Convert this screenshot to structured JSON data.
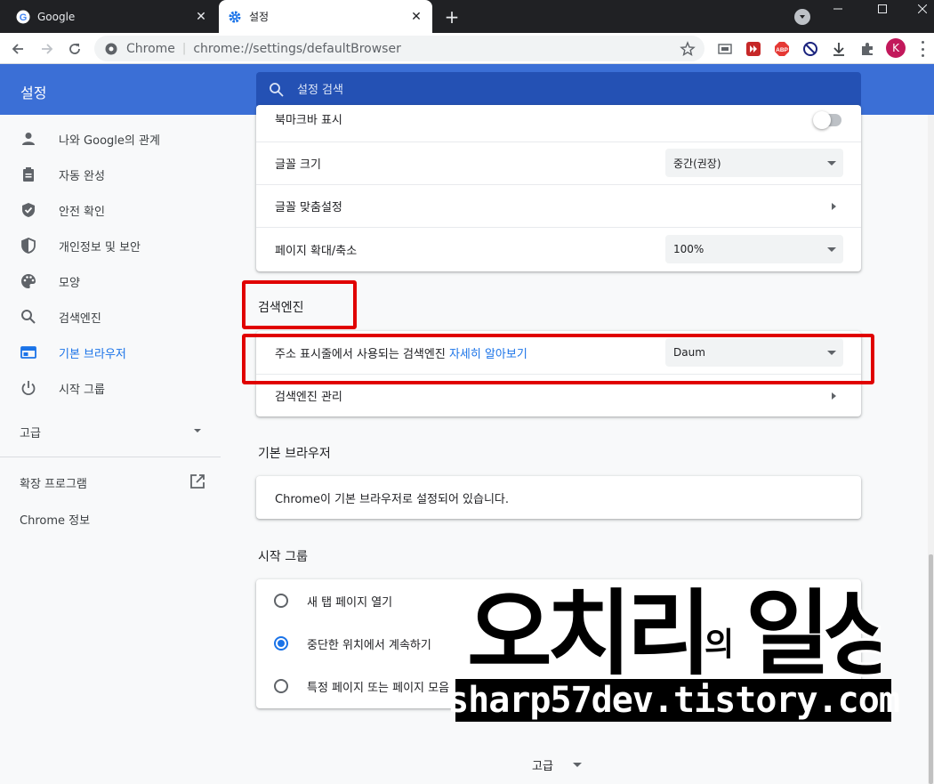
{
  "tabs": [
    {
      "title": "Google"
    },
    {
      "title": "설정"
    }
  ],
  "toolbar": {
    "chip_label": "Chrome",
    "url": "chrome://settings/defaultBrowser",
    "avatar_initial": "K"
  },
  "header": {
    "title": "설정",
    "search_placeholder": "설정 검색"
  },
  "sidebar": {
    "items": [
      {
        "label": "나와 Google의 관계",
        "icon": "person-icon"
      },
      {
        "label": "자동 완성",
        "icon": "clipboard-icon"
      },
      {
        "label": "안전 확인",
        "icon": "shield-check-icon"
      },
      {
        "label": "개인정보 및 보안",
        "icon": "shield-half-icon"
      },
      {
        "label": "모양",
        "icon": "palette-icon"
      },
      {
        "label": "검색엔진",
        "icon": "search-icon"
      },
      {
        "label": "기본 브라우저",
        "icon": "browser-icon",
        "selected": true
      },
      {
        "label": "시작 그룹",
        "icon": "power-icon"
      }
    ],
    "advanced": "고급",
    "extensions": "확장 프로그램",
    "about": "Chrome 정보"
  },
  "appearance": {
    "bookmark_bar_label": "북마크바 표시",
    "bookmark_bar_enabled": false,
    "font_size_label": "글꼴 크기",
    "font_size_value": "중간(권장)",
    "customize_fonts_label": "글꼴 맞춤설정",
    "page_zoom_label": "페이지 확대/축소",
    "page_zoom_value": "100%"
  },
  "search_engine": {
    "section_title": "검색엔진",
    "address_bar_label": "주소 표시줄에서 사용되는 검색엔진",
    "learn_more": "자세히 알아보기",
    "engine_value": "Daum",
    "manage_label": "검색엔진 관리"
  },
  "default_browser": {
    "section_title": "기본 브라우저",
    "status": "Chrome이 기본 브라우저로 설정되어 있습니다."
  },
  "startup": {
    "section_title": "시작 그룹",
    "options": [
      {
        "label": "새 탭 페이지 열기",
        "checked": false
      },
      {
        "label": "중단한 위치에서 계속하기",
        "checked": true
      },
      {
        "label": "특정 페이지 또는 페이지 모음",
        "checked": false
      }
    ]
  },
  "footer": {
    "advanced": "고급"
  },
  "watermark": {
    "title": "오치리의 일상",
    "url": "sharp57dev.tistory.com"
  },
  "colors": {
    "header_blue": "#3b6fd6",
    "search_blue": "#2451b4",
    "accent": "#1a73e8",
    "highlight_red": "#e00000"
  }
}
